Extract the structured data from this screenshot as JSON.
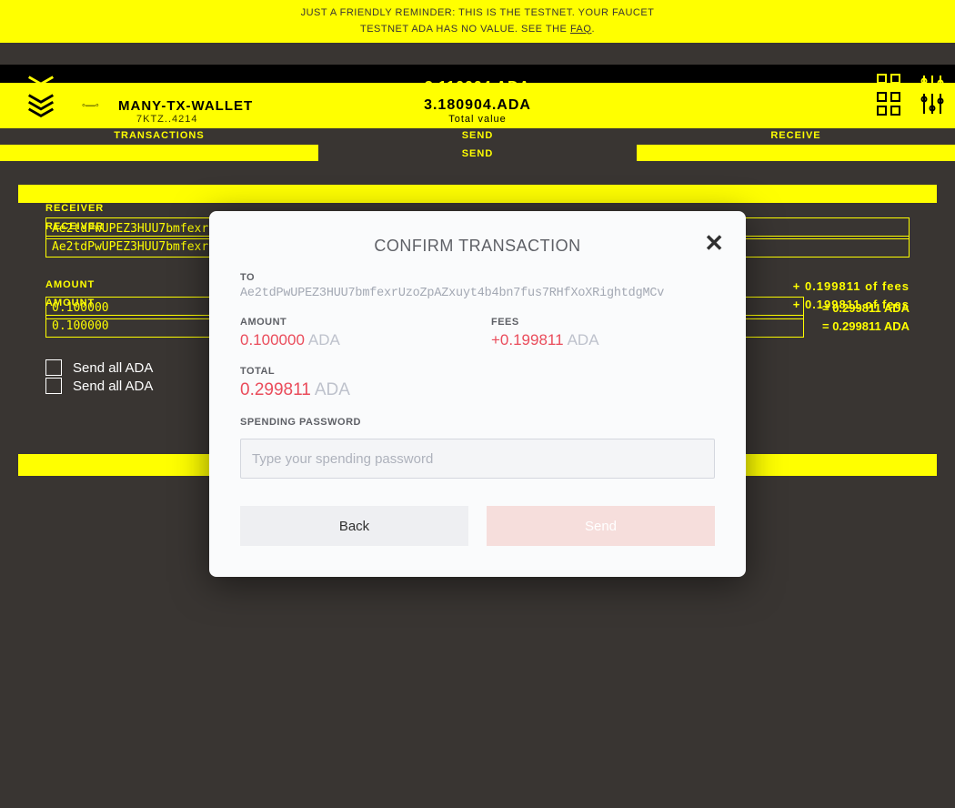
{
  "banner": {
    "line1": "JUST A FRIENDLY REMINDER: THIS IS THE TESTNET. YOUR FAUCET",
    "line2a": "TESTNET ADA HAS NO VALUE. SEE THE ",
    "line2b": "FAQ",
    "line2c": "."
  },
  "header": {
    "wallet_name": "MANY-TX-WALLET",
    "wallet_sub": "7KTZ..4214",
    "balance": "3.110004 ADA",
    "balance_sub": "Total value",
    "balance_alt": "3.180904.ADA"
  },
  "tabs": {
    "t1": "TRANSACTIONS",
    "t2": "SEND",
    "t3": "RECEIVE"
  },
  "form": {
    "receiver_label": "RECEIVER",
    "receiver_value": "Ae2tdPwUPEZ3HUU7bmfexrUzoZpAZxuyt4b4bn7fus7RHfXoXRightdgMCv",
    "amount_label": "AMOUNT",
    "amount_value": "0.100000",
    "fee_note": "+ 0.199811 of fees",
    "eq_note": "= 0.299811 ADA",
    "send_all": "Send all ADA"
  },
  "modal": {
    "title": "CONFIRM TRANSACTION",
    "to_label": "TO",
    "to_value": "Ae2tdPwUPEZ3HUU7bmfexrUzoZpAZxuyt4b4bn7fus7RHfXoXRightdgMCv",
    "amount_label": "AMOUNT",
    "amount_value": "0.100000",
    "fees_label": "FEES",
    "fees_value": "+0.199811",
    "total_label": "TOTAL",
    "total_value": "0.299811",
    "currency": "ADA",
    "pw_label": "SPENDING PASSWORD",
    "pw_placeholder": "Type your spending password",
    "back": "Back",
    "send": "Send"
  }
}
